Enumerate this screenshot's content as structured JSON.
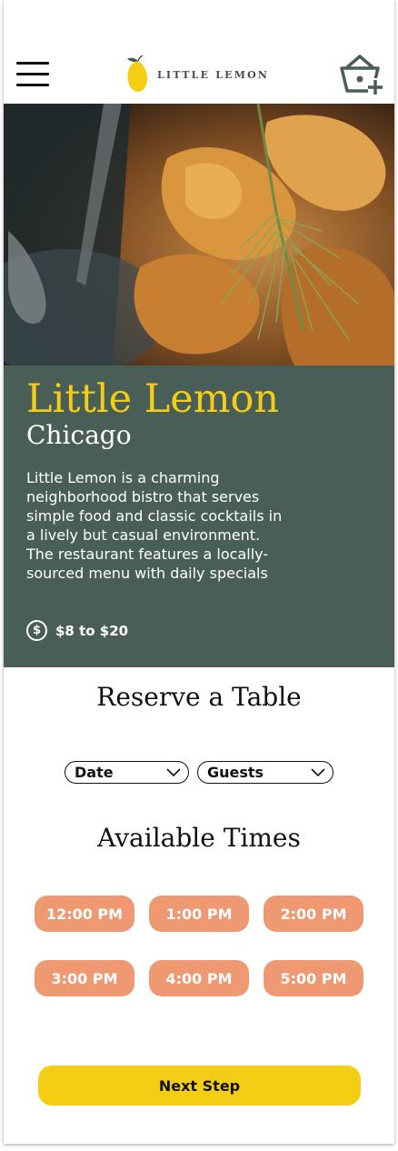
{
  "header": {
    "brand": "LITTLE LEMON",
    "menu_icon": "hamburger-menu-icon",
    "cart_icon": "basket-add-icon"
  },
  "hero": {
    "image": "roasted-food-photo"
  },
  "restaurant": {
    "name": "Little Lemon",
    "city": "Chicago",
    "description": "Little Lemon is a charming neighborhood bistro that serves simple food and classic cocktails in a lively but casual environment. The restaurant features a locally-sourced menu with daily specials",
    "price_icon": "dollar-circle-icon",
    "price_range": "$8 to $20"
  },
  "reservation": {
    "title": "Reserve a Table",
    "date_label": "Date",
    "guests_label": "Guests",
    "times_title": "Available Times",
    "times": [
      "12:00 PM",
      "1:00 PM",
      "2:00 PM",
      "3:00 PM",
      "4:00 PM",
      "5:00 PM"
    ],
    "next_label": "Next Step"
  },
  "colors": {
    "primary_green": "#495e57",
    "primary_yellow": "#f4ce14",
    "salmon": "#ee9972"
  }
}
